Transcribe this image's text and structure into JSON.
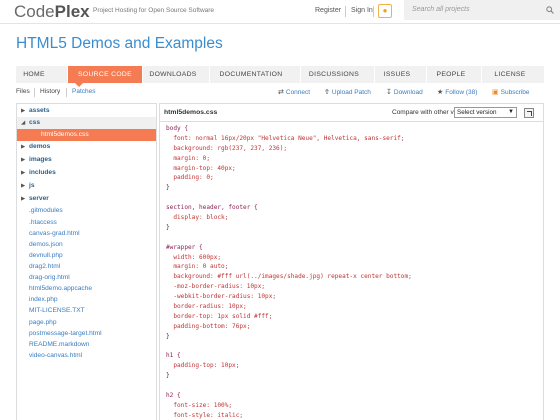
{
  "header": {
    "logo_text_a": "Code",
    "logo_text_b": "Plex",
    "tagline": "Project Hosting for Open Source Software",
    "register": "Register",
    "sign_in": "Sign In",
    "search_placeholder": "Search all projects"
  },
  "project": {
    "title": "HTML5 Demos and Examples"
  },
  "nav": {
    "tabs": [
      "HOME",
      "SOURCE CODE",
      "DOWNLOADS",
      "DOCUMENTATION",
      "DISCUSSIONS",
      "ISSUES",
      "PEOPLE",
      "LICENSE"
    ],
    "active": "SOURCE CODE"
  },
  "subnav": {
    "files": "Files",
    "history": "History",
    "patches": "Patches",
    "actions": [
      "Connect",
      "Upload Patch",
      "Download",
      "Follow (38)",
      "Subscribe"
    ]
  },
  "tree": [
    {
      "type": "folder",
      "label": "assets",
      "expanded": false
    },
    {
      "type": "folder",
      "label": "css",
      "expanded": true
    },
    {
      "type": "file",
      "label": "html5demos.css",
      "selected": true
    },
    {
      "type": "folder",
      "label": "demos",
      "expanded": false
    },
    {
      "type": "folder",
      "label": "images",
      "expanded": false
    },
    {
      "type": "folder",
      "label": "includes",
      "expanded": false
    },
    {
      "type": "folder",
      "label": "js",
      "expanded": false
    },
    {
      "type": "folder",
      "label": "server",
      "expanded": false
    },
    {
      "type": "file",
      "label": ".gitmodules"
    },
    {
      "type": "file",
      "label": ".htaccess"
    },
    {
      "type": "file",
      "label": "canvas-grad.html"
    },
    {
      "type": "file",
      "label": "demos.json"
    },
    {
      "type": "file",
      "label": "devnull.php"
    },
    {
      "type": "file",
      "label": "drag2.html"
    },
    {
      "type": "file",
      "label": "drag-orig.html"
    },
    {
      "type": "file",
      "label": "html5demo.appcache"
    },
    {
      "type": "file",
      "label": "index.php"
    },
    {
      "type": "file",
      "label": "MIT-LICENSE.TXT"
    },
    {
      "type": "file",
      "label": "page.php"
    },
    {
      "type": "file",
      "label": "postmessage-target.html"
    },
    {
      "type": "file",
      "label": "README.markdown"
    },
    {
      "type": "file",
      "label": "video-canvas.html"
    }
  ],
  "code_view": {
    "filename": "html5demos.css",
    "compare_label": "Compare with other versions:",
    "version_select": "Select version",
    "lines": [
      "body {",
      "  font: normal 16px/20px \"Helvetica Neue\", Helvetica, sans-serif;",
      "  background: rgb(237, 237, 236);",
      "  margin: 0;",
      "  margin-top: 40px;",
      "  padding: 0;",
      "}",
      "",
      "section, header, footer {",
      "  display: block;",
      "}",
      "",
      "#wrapper {",
      "  width: 600px;",
      "  margin: 0 auto;",
      "  background: #fff url(../images/shade.jpg) repeat-x center bottom;",
      "  -moz-border-radius: 10px;",
      "  -webkit-border-radius: 10px;",
      "  border-radius: 10px;",
      "  border-top: 1px solid #fff;",
      "  padding-bottom: 76px;",
      "}",
      "",
      "h1 {",
      "  padding-top: 10px;",
      "}",
      "",
      "h2 {",
      "  font-size: 100%;",
      "  font-style: italic;"
    ]
  },
  "colors": {
    "accent": "#f47b52",
    "link": "#3a8dd0"
  }
}
